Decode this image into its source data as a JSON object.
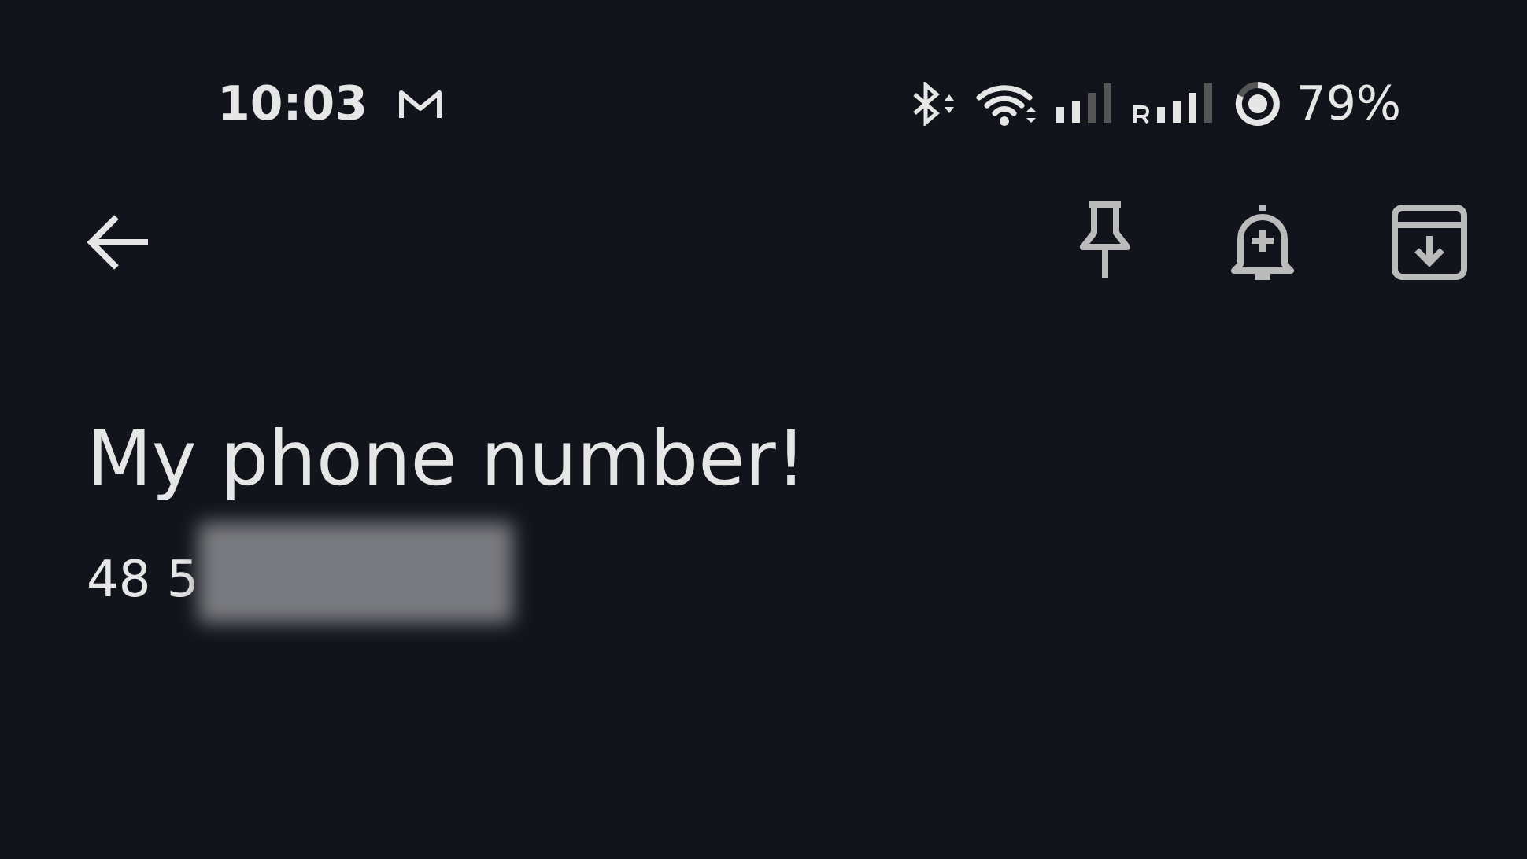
{
  "status_bar": {
    "time": "10:03",
    "battery": "79%"
  },
  "note": {
    "title": "My phone number!",
    "body": "48 5",
    "body_redacted": true
  }
}
